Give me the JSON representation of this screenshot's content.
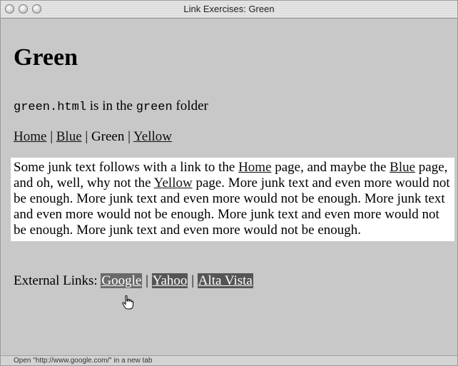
{
  "window": {
    "title": "Link Exercises: Green"
  },
  "page": {
    "heading": "Green",
    "folder_line": {
      "file": "green.html",
      "mid": " is in the ",
      "folder": "green",
      "end": " folder"
    },
    "nav": {
      "items": [
        {
          "label": "Home",
          "link": true
        },
        {
          "label": "Blue",
          "link": true
        },
        {
          "label": "Green",
          "link": false
        },
        {
          "label": "Yellow",
          "link": true
        }
      ],
      "separator": " | "
    },
    "junk": {
      "t1": "Some junk text follows with a link to the ",
      "home": "Home",
      "t2": " page, and maybe the ",
      "blue": "Blue",
      "t3": " page, and oh, well, why not the ",
      "yellow": "Yellow",
      "t4": " page. More junk text and even more would not be enough. More junk text and even more would not be enough. More junk text and even more would not be enough. More junk text and even more would not be enough. More junk text and even more would not be enough."
    },
    "external": {
      "label": "External Links: ",
      "links": [
        "Google",
        "Yahoo",
        "Alta Vista"
      ],
      "separator": " | "
    }
  },
  "status": {
    "text": "Open \"http://www.google.com/\" in a new tab"
  }
}
